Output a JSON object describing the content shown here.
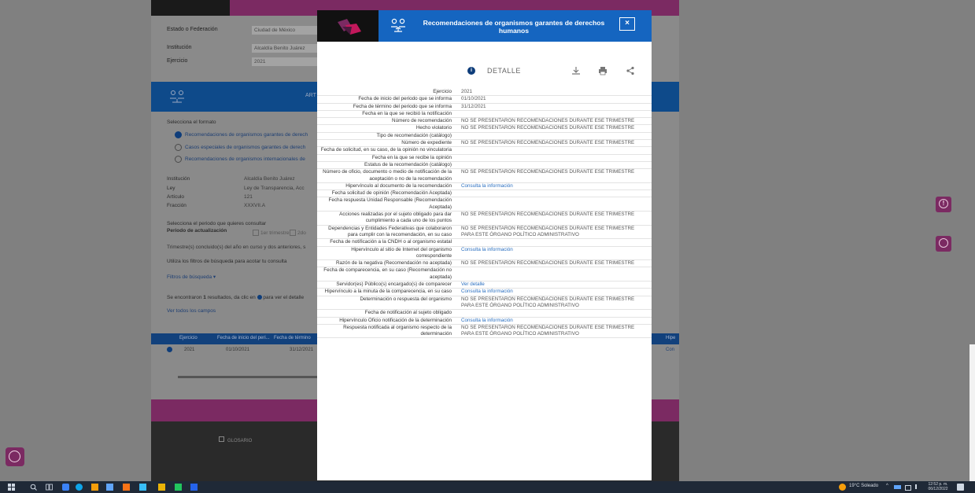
{
  "background": {
    "form": [
      {
        "label": "Estado o Federación",
        "value": "Ciudad de México"
      },
      {
        "label": "Institución",
        "value": "Alcaldía Benito Juárez"
      },
      {
        "label": "Ejercicio",
        "value": "2021"
      }
    ],
    "band_label": "ART",
    "select_format": "Selecciona el formato",
    "formats": [
      "Recomendaciones de organismos garantes de derech",
      "Casos especiales de organismos garantes de derech",
      "Recomendaciones de organismos internacionales de"
    ],
    "info": [
      {
        "label": "Institución",
        "value": "Alcaldía Benito Juárez"
      },
      {
        "label": "Ley",
        "value": "Ley de Transparencia, Acc"
      },
      {
        "label": "Artículo",
        "value": "121"
      },
      {
        "label": "Fracción",
        "value": "XXXVII.A"
      }
    ],
    "select_period": "Selecciona el periodo que quieres consultar",
    "period_label": "Periodo de actualización",
    "period_option1": "1er trimestre",
    "period_option2": "2do",
    "trimester_note": "Trimestre(s) concluido(s) del año en curso y dos anteriores, s",
    "filter_note": "Utiliza los filtros de búsqueda para acotar tu consulta",
    "filters_link": "Filtros de búsqueda ▾",
    "results_pre": "Se encontraron ",
    "results_count": "1",
    "results_mid": " resultados, da clic en ",
    "results_post": " para ver el detalle",
    "see_all": "Ver todos los campos",
    "table_headers": [
      "Ejercicio",
      "Fecha de inicio del peri...",
      "Fecha de término",
      "Hipe"
    ],
    "table_row": {
      "ejercicio": "2021",
      "inicio": "01/10/2021",
      "termino": "31/12/2021",
      "extra": "Con"
    },
    "footer_glossary": "GLOSARIO"
  },
  "modal": {
    "title": "Recomendaciones de organismos garantes de derechos humanos",
    "close_label": "×",
    "detail_label": "DETALLE",
    "rows": [
      {
        "label": "Ejercicio",
        "value": "2021"
      },
      {
        "label": "Fecha de inicio del periodo que se informa",
        "value": "01/10/2021"
      },
      {
        "label": "Fecha de término del periodo que se informa",
        "value": "31/12/2021"
      },
      {
        "label": "Fecha en la que se recibió la notificación",
        "value": ""
      },
      {
        "label": "Número de recomendación",
        "value": "NO SE PRESENTARON RECOMENDACIONES DURANTE ESE TRIMESTRE"
      },
      {
        "label": "Hecho violatorio",
        "value": "NO SE PRESENTARON RECOMENDACIONES DURANTE ESE TRIMESTRE"
      },
      {
        "label": "Tipo de recomendación (catálogo)",
        "value": ""
      },
      {
        "label": "Número de expediente",
        "value": "NO SE PRESENTARON RECOMENDACIONES DURANTE ESE TRIMESTRE"
      },
      {
        "label": "Fecha de solicitud, en su caso, de la opinión no vinculatoria",
        "value": ""
      },
      {
        "label": "Fecha en la que se recibe la opinión",
        "value": ""
      },
      {
        "label": "Estatus de la recomendación (catálogo)",
        "value": ""
      },
      {
        "label": "Número de oficio, documento o medio de notificación de la aceptación o no de la recomendación",
        "value": "NO SE PRESENTARON RECOMENDACIONES DURANTE ESE TRIMESTRE"
      },
      {
        "label": "Hipervínculo al documento de la recomendación",
        "value": "Consulta la información",
        "link": true
      },
      {
        "label": "Fecha solicitud de opinión (Recomendación Aceptada)",
        "value": ""
      },
      {
        "label": "Fecha respuesta Unidad Responsable (Recomendación Aceptada)",
        "value": ""
      },
      {
        "label": "Acciones realizadas por el sujeto obligado para dar cumplimiento a cada uno de los puntos",
        "value": "NO SE PRESENTARON RECOMENDACIONES DURANTE ESE TRIMESTRE"
      },
      {
        "label": "Dependencias y Entidades Federativas que colaboraron para cumplir con la recomendación, en su caso",
        "value": "NO SE PRESENTARON RECOMENDACIONES DURANTE ESE TRIMESTRE PARA ESTE ÓRGANO POLÍTICO ADMINISTRATIVO"
      },
      {
        "label": "Fecha de notificación a la CNDH o al organismo estatal",
        "value": ""
      },
      {
        "label": "Hipervínculo al sitio de Internet del organismo correspondiente",
        "value": "Consulta la información",
        "link": true
      },
      {
        "label": "Razón de la negativa (Recomendación no aceptada)",
        "value": "NO SE PRESENTARON RECOMENDACIONES DURANTE ESE TRIMESTRE"
      },
      {
        "label": "Fecha de comparecencia, en su caso (Recomendación no aceptada)",
        "value": ""
      },
      {
        "label": "Servidor(es) Público(s) encargado(s) de comparecer",
        "value": "Ver detalle",
        "link": true
      },
      {
        "label": "Hipervínculo a la minuta de la comparecencia, en su caso",
        "value": "Consulta la información",
        "link": true
      },
      {
        "label": "Determinación o respuesta del organismo",
        "value": "NO SE PRESENTARON RECOMENDACIONES DURANTE ESE TRIMESTRE PARA ESTE ÓRGANO POLÍTICO ADMINISTRATIVO"
      },
      {
        "label": "Fecha de notificación al sujeto obligado",
        "value": ""
      },
      {
        "label": "Hipervínculo Oficio notificación de la determinación",
        "value": "Consulta la información",
        "link": true
      },
      {
        "label": "Respuesta notificada al organismo respecto de la determinación",
        "value": "NO SE PRESENTARON RECOMENDACIONES DURANTE ESE TRIMESTRE PARA ESTE ÓRGANO POLÍTICO ADMINISTRATIVO"
      }
    ]
  },
  "taskbar": {
    "weather": "19°C Soleado",
    "time": "12:52 p. m.",
    "date": "06/12/2022"
  },
  "colors": {
    "brand": "#7b2a62",
    "blue": "#1565c0",
    "navy": "#0e3d7a",
    "link": "#2a6fc0"
  }
}
